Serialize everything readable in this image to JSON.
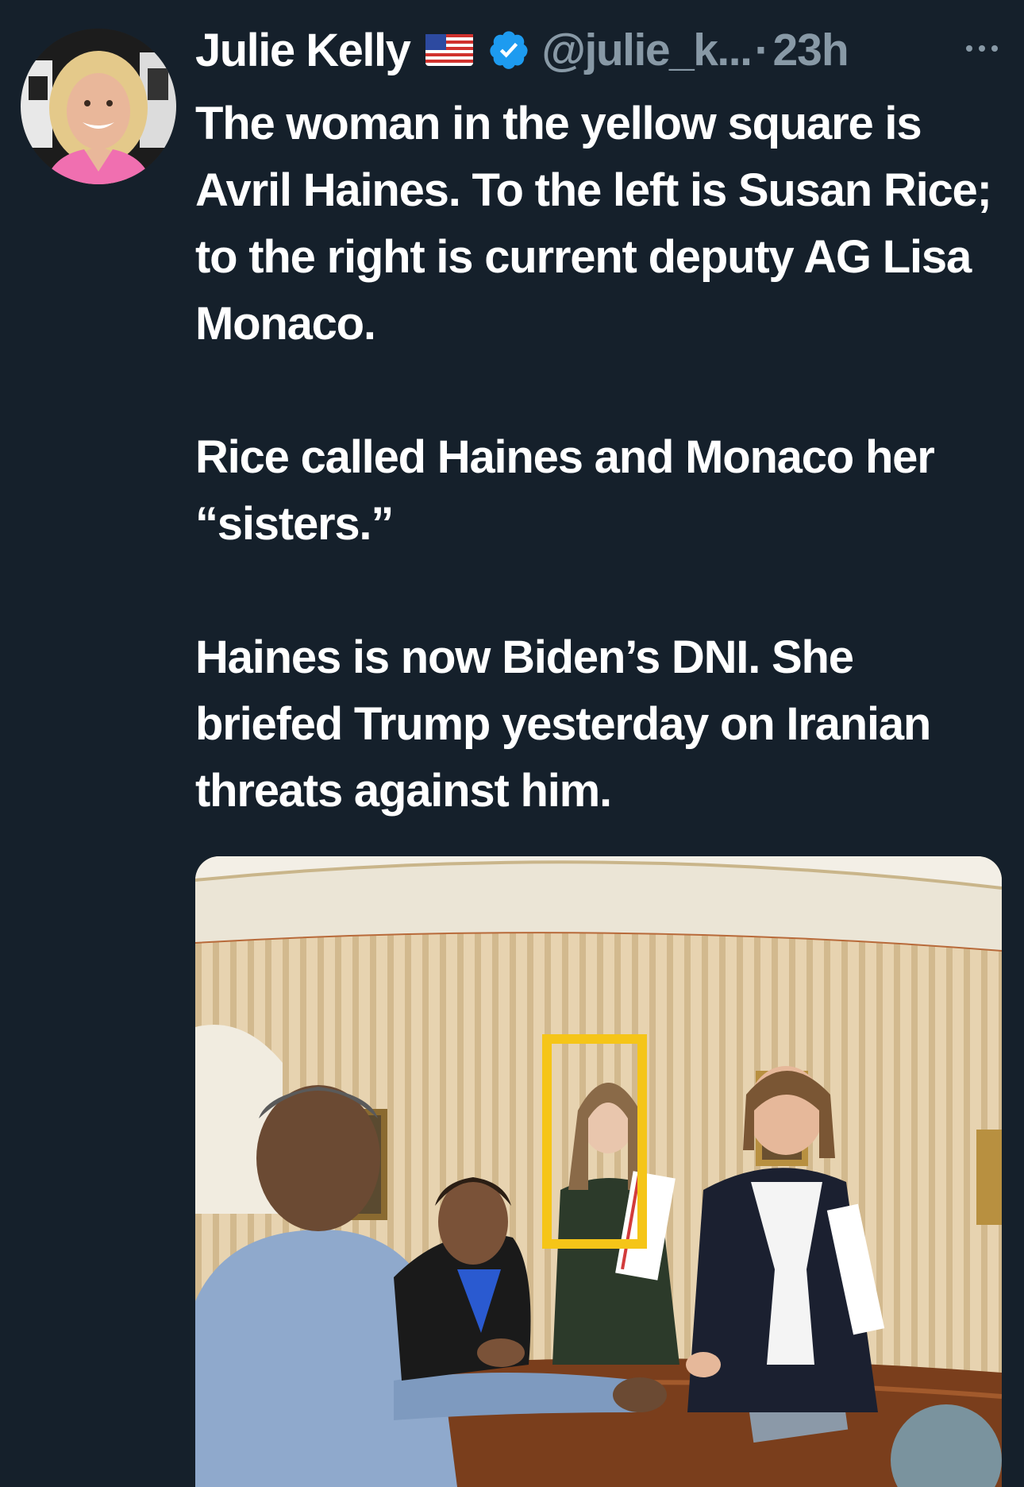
{
  "author": {
    "name": "Julie Kelly",
    "handle": "@julie_k...",
    "separator": "·",
    "timestamp": "23h",
    "flag_icon": "us-flag-icon",
    "verified_icon": "verified-badge-icon",
    "verified_color": "#1d9bf0"
  },
  "more_menu": {
    "icon": "more-horizontal-icon"
  },
  "tweet": {
    "paragraphs": [
      "The woman in the yellow square is Avril Haines. To the left is Susan Rice; to the right is current deputy AG Lisa Monaco.",
      "Rice called Haines and Monaco her “sisters.”",
      "Haines is now Biden’s DNI. She briefed Trump yesterday on Iranian threats against him."
    ]
  },
  "media": {
    "highlight_color": "#f5c518"
  },
  "colors": {
    "background": "#15202b",
    "text": "#ffffff",
    "secondary_text": "#8899a6"
  }
}
